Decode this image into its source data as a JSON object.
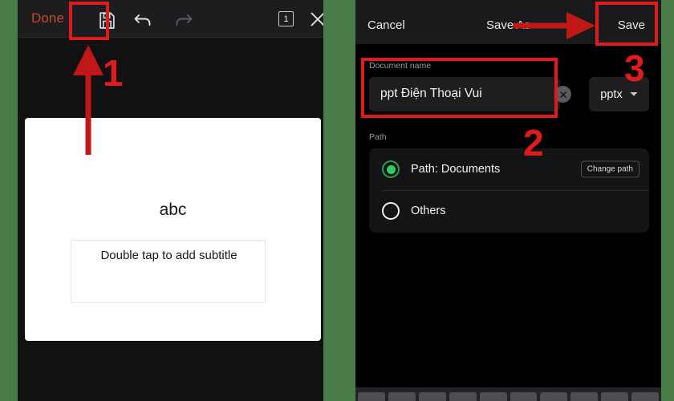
{
  "background_color": "#4a7c4a",
  "annotations": {
    "accent_color": "#e01b1b",
    "step1": "1",
    "step2": "2",
    "step3": "3"
  },
  "left_panel": {
    "background": "#111113",
    "toolbar": {
      "background": "#1d1d20",
      "done_label": "Done",
      "done_color": "#c2492f",
      "save_icon": "floppy-disk-save-icon",
      "undo_icon": "undo-arrow-icon",
      "redo_icon": "redo-arrow-icon",
      "redo_disabled": true,
      "page_count": "1",
      "close_icon": "close-x-icon"
    },
    "slide": {
      "background": "#ffffff",
      "title": "abc",
      "subtitle_placeholder": "Double tap to add subtitle"
    }
  },
  "right_panel": {
    "background": "#000000",
    "nav": {
      "cancel_label": "Cancel",
      "title": "Save As",
      "save_label": "Save"
    },
    "document_name": {
      "label": "Document name",
      "value": "ppt Điện Thoại Vui",
      "clear_icon": "clear-circle-x-icon",
      "extension": "pptx",
      "extension_chevron": "chevron-down-icon"
    },
    "path": {
      "label": "Path",
      "options": [
        {
          "label": "Path: Documents",
          "selected": true,
          "action_label": "Change path",
          "radio_color": "#2ecc63"
        },
        {
          "label": "Others",
          "selected": false,
          "action_label": "",
          "radio_color": "#f2f2f5"
        }
      ]
    },
    "keyboard": {
      "visible": true,
      "key_count": 10
    }
  }
}
